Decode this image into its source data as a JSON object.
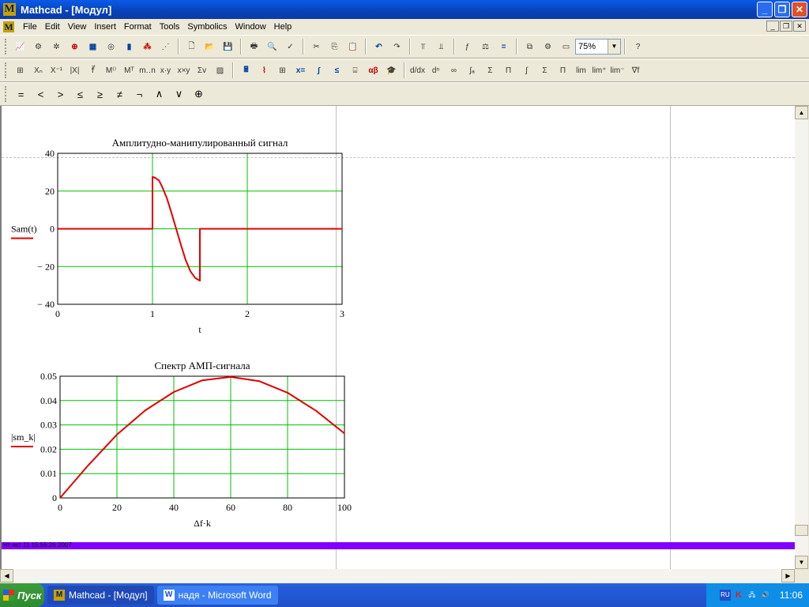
{
  "window": {
    "title": "Mathcad - [Модул]"
  },
  "menu": {
    "items": [
      "File",
      "Edit",
      "View",
      "Insert",
      "Format",
      "Tools",
      "Symbolics",
      "Window",
      "Help"
    ]
  },
  "toolbar": {
    "zoom": "75%"
  },
  "worksheet": {
    "stamp": "Чт окт 11 15:55:26 2007"
  },
  "chart_data": [
    {
      "type": "line",
      "title": "Амплитудно-манипулированный сигнал",
      "xlabel": "t",
      "ylabel": "Sam(t)",
      "xlim": [
        0,
        3
      ],
      "ylim": [
        -40,
        40
      ],
      "xticks": [
        0,
        1,
        2,
        3
      ],
      "yticks": [
        40,
        20,
        0,
        -20,
        -40
      ],
      "tick_labels_x": [
        "0",
        "1",
        "2",
        "3"
      ],
      "tick_labels_y": [
        "40",
        "20",
        "0",
        "− 20",
        "− 40"
      ],
      "grid": true,
      "series": [
        {
          "color": "#e00000",
          "x": [
            0,
            1,
            1,
            1.03,
            1.07,
            1.1,
            1.15,
            1.2,
            1.25,
            1.3,
            1.35,
            1.4,
            1.45,
            1.5,
            1.5,
            2,
            3
          ],
          "y": [
            0,
            0,
            27.5,
            27,
            25.5,
            22.5,
            16.5,
            8.5,
            0,
            -8.5,
            -16.5,
            -22.5,
            -26,
            -27.5,
            0,
            0,
            0
          ]
        }
      ]
    },
    {
      "type": "line",
      "title": "Спектр АМП-сигнала",
      "xlabel": "Δf·k",
      "ylabel": "|sm_k|",
      "xlim": [
        0,
        100
      ],
      "ylim": [
        0,
        0.05
      ],
      "xticks": [
        0,
        20,
        40,
        60,
        80,
        100
      ],
      "yticks": [
        0.05,
        0.04,
        0.03,
        0.02,
        0.01,
        0
      ],
      "tick_labels_x": [
        "0",
        "20",
        "40",
        "60",
        "80",
        "100"
      ],
      "tick_labels_y": [
        "0.05",
        "0.04",
        "0.03",
        "0.02",
        "0.01",
        "0"
      ],
      "grid": true,
      "series": [
        {
          "color": "#e00000",
          "x": [
            0,
            10,
            20,
            30,
            40,
            50,
            60,
            70,
            80,
            90,
            100
          ],
          "y": [
            0,
            0.0135,
            0.026,
            0.036,
            0.0435,
            0.0483,
            0.0497,
            0.048,
            0.0432,
            0.0358,
            0.0265
          ]
        }
      ]
    }
  ],
  "taskbar": {
    "start": "Пуск",
    "tasks": [
      "Mathcad - [Модул]",
      "надя - Microsoft Word"
    ],
    "clock": "11:06",
    "lang": "RU"
  }
}
